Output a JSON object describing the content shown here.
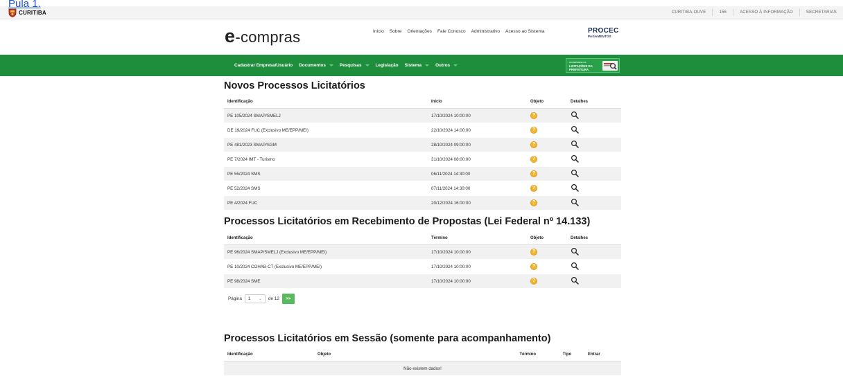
{
  "skip_link": "Pula 1.",
  "topbar": {
    "logo_text": "CURITIBA",
    "links": [
      "CURITIBA-OUVE",
      "156",
      "ACESSO À INFORMAÇÃO",
      "SECRETARIAS"
    ]
  },
  "header": {
    "brand_e": "e",
    "brand_rest": "-compras",
    "nav": [
      "Início",
      "Sobre",
      "Orientações",
      "Fale Conosco",
      "Administrativo",
      "Acesso ao Sistema"
    ],
    "procec_title": "PROCEC",
    "procec_sub": "PAGAMENTOS"
  },
  "green_nav": {
    "items": [
      {
        "label": "Cadastrar Empresa/Usuário",
        "dropdown": false
      },
      {
        "label": "Documentos",
        "dropdown": true
      },
      {
        "label": "Pesquisas",
        "dropdown": true
      },
      {
        "label": "Legislação",
        "dropdown": false
      },
      {
        "label": "Sistema",
        "dropdown": true
      },
      {
        "label": "Outros",
        "dropdown": true
      }
    ],
    "banner_small": "ACOMPANHE AS",
    "banner_big": "LICITAÇÕES DA PREFEITURA"
  },
  "novos": {
    "title": "Novos Processos Licitatórios",
    "headers": [
      "Identificação",
      "Início",
      "Objeto",
      "Detalhes"
    ],
    "rows": [
      {
        "id": "PE 105/2024 SMAP/SMELJ",
        "date": "17/10/2024 10:00:00"
      },
      {
        "id": "DE 19/2024 FUC (Exclusivo ME/EPP/MEI)",
        "date": "22/10/2024 14:00:00"
      },
      {
        "id": "PE 481/2023 SMAP/SGM",
        "date": "28/10/2024 09:00:00"
      },
      {
        "id": "PE 7/2024 IMT - Turismo",
        "date": "31/10/2024 08:00:00"
      },
      {
        "id": "PE 55/2024 SMS",
        "date": "06/11/2024 14:30:00"
      },
      {
        "id": "PE 52/2024 SMS",
        "date": "07/11/2024 14:30:00"
      },
      {
        "id": "PE 4/2024 FUC",
        "date": "20/12/2024 16:00:00"
      }
    ]
  },
  "recebimento": {
    "title": "Processos Licitatórios em Recebimento de Propostas (Lei Federal nº 14.133)",
    "headers": [
      "Identificação",
      "Término",
      "Objeto",
      "Detalhes"
    ],
    "rows": [
      {
        "id": "PE 96/2024 SMAP/SMELJ (Exclusivo ME/EPP/MEI)",
        "date": "17/10/2024 10:00:00"
      },
      {
        "id": "PE 10/2024 COHAB-CT (Exclusivo ME/EPP/MEI)",
        "date": "17/10/2024 10:00:00"
      },
      {
        "id": "PE 98/2024 SME",
        "date": "17/10/2024 10:00:00"
      }
    ]
  },
  "pager": {
    "label": "Página",
    "current": "1",
    "of_text": "de 12",
    "next_label": ">>"
  },
  "sessao": {
    "title": "Processos Licitatórios em Sessão (somente para acompanhamento)",
    "headers": [
      "Identificação",
      "Objeto",
      "Término",
      "Tipo",
      "Entrar"
    ],
    "empty": "Não existem dados!"
  },
  "colors": {
    "green_nav": "#1f8e3c",
    "object_icon": "#f1b52e",
    "pager_next": "#5ab95e"
  },
  "icons": {
    "object": "question-circle-icon",
    "details": "magnifier-icon"
  }
}
